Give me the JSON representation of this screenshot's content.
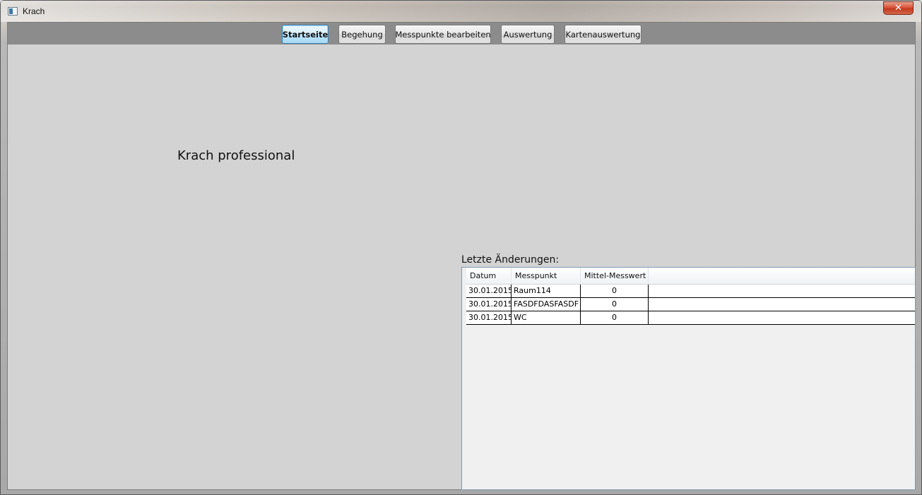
{
  "window": {
    "title": "Krach",
    "close_label": "✕"
  },
  "nav": {
    "buttons": [
      {
        "label": "Startseite",
        "active": true
      },
      {
        "label": "Begehung",
        "active": false
      },
      {
        "label": "Messpunkte bearbeiten",
        "active": false
      },
      {
        "label": "Auswertung",
        "active": false
      },
      {
        "label": "Kartenauswertung",
        "active": false
      }
    ]
  },
  "main": {
    "heading": "Krach professional",
    "changes_label": "Letzte Änderungen:"
  },
  "grid": {
    "columns": [
      "Datum",
      "Messpunkt",
      "Mittel-Messwert"
    ],
    "rows": [
      [
        "30.01.2015",
        "Raum114",
        "0"
      ],
      [
        "30.01.2015",
        "FASDFDASFASDF",
        "0"
      ],
      [
        "30.01.2015",
        "WC",
        "0"
      ]
    ]
  },
  "colors": {
    "nav_bar": "#8c8c8c",
    "client_bg": "#d3d3d3",
    "grid_bg": "#f0f0f0",
    "active_button_border": "#3c7fb1"
  }
}
